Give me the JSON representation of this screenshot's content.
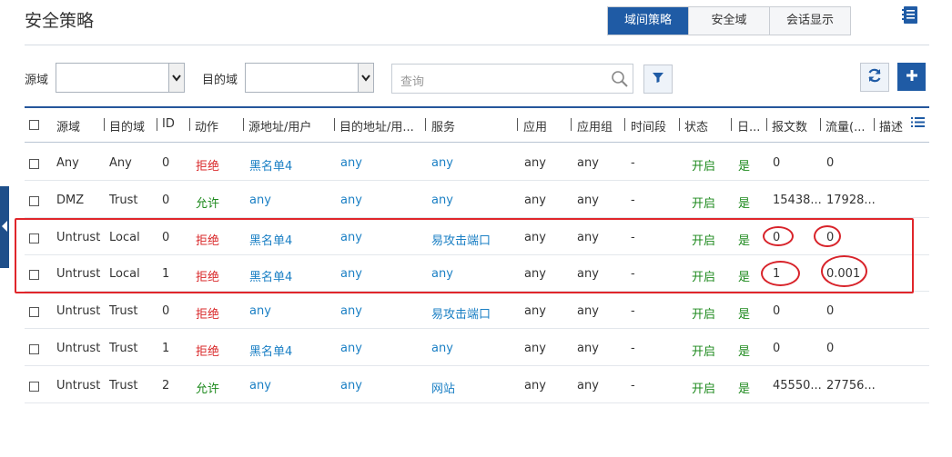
{
  "page": {
    "title": "安全策略"
  },
  "tabs": [
    {
      "label": "域间策略",
      "active": true
    },
    {
      "label": "安全域",
      "active": false
    },
    {
      "label": "会话显示",
      "active": false
    }
  ],
  "filters": {
    "source_zone_label": "源域",
    "source_zone_value": "",
    "dest_zone_label": "目的域",
    "dest_zone_value": "",
    "search_placeholder": "查询"
  },
  "columns": [
    "源域",
    "目的域",
    "ID",
    "动作",
    "源地址/用户",
    "目的地址/用...",
    "服务",
    "应用",
    "应用组",
    "时间段",
    "状态",
    "日...",
    "报文数",
    "流量(...",
    "描述"
  ],
  "rows": [
    {
      "src_zone": "Any",
      "dst_zone": "Any",
      "id": "0",
      "action": "拒绝",
      "src_addr": "黑名单4",
      "dst_addr": "any",
      "service": "any",
      "app": "any",
      "app_group": "any",
      "time": "-",
      "status": "开启",
      "log": "是",
      "packets": "0",
      "traffic": "0"
    },
    {
      "src_zone": "DMZ",
      "dst_zone": "Trust",
      "id": "0",
      "action": "允许",
      "src_addr": "any",
      "dst_addr": "any",
      "service": "any",
      "app": "any",
      "app_group": "any",
      "time": "-",
      "status": "开启",
      "log": "是",
      "packets": "15438...",
      "traffic": "17928..."
    },
    {
      "src_zone": "Untrust",
      "dst_zone": "Local",
      "id": "0",
      "action": "拒绝",
      "src_addr": "黑名单4",
      "dst_addr": "any",
      "service": "易攻击端口",
      "app": "any",
      "app_group": "any",
      "time": "-",
      "status": "开启",
      "log": "是",
      "packets": "0",
      "traffic": "0"
    },
    {
      "src_zone": "Untrust",
      "dst_zone": "Local",
      "id": "1",
      "action": "拒绝",
      "src_addr": "黑名单4",
      "dst_addr": "any",
      "service": "any",
      "app": "any",
      "app_group": "any",
      "time": "-",
      "status": "开启",
      "log": "是",
      "packets": "1",
      "traffic": "0.001"
    },
    {
      "src_zone": "Untrust",
      "dst_zone": "Trust",
      "id": "0",
      "action": "拒绝",
      "src_addr": "any",
      "dst_addr": "any",
      "service": "易攻击端口",
      "app": "any",
      "app_group": "any",
      "time": "-",
      "status": "开启",
      "log": "是",
      "packets": "0",
      "traffic": "0"
    },
    {
      "src_zone": "Untrust",
      "dst_zone": "Trust",
      "id": "1",
      "action": "拒绝",
      "src_addr": "黑名单4",
      "dst_addr": "any",
      "service": "any",
      "app": "any",
      "app_group": "any",
      "time": "-",
      "status": "开启",
      "log": "是",
      "packets": "0",
      "traffic": "0"
    },
    {
      "src_zone": "Untrust",
      "dst_zone": "Trust",
      "id": "2",
      "action": "允许",
      "src_addr": "any",
      "dst_addr": "any",
      "service": "网站",
      "app": "any",
      "app_group": "any",
      "time": "-",
      "status": "开启",
      "log": "是",
      "packets": "45550...",
      "traffic": "27756..."
    }
  ],
  "icons": {
    "doc": "document-icon",
    "search": "search-icon",
    "filter": "filter-icon",
    "refresh": "refresh-icon",
    "add": "plus-icon",
    "columns": "column-settings-icon",
    "sidebar": "collapse-arrow-icon"
  },
  "colors": {
    "accent": "#1f5ba5",
    "deny": "#d9282a",
    "allow": "#1e8a1e",
    "link": "#1a7fc4",
    "annotation": "#e0262b"
  }
}
